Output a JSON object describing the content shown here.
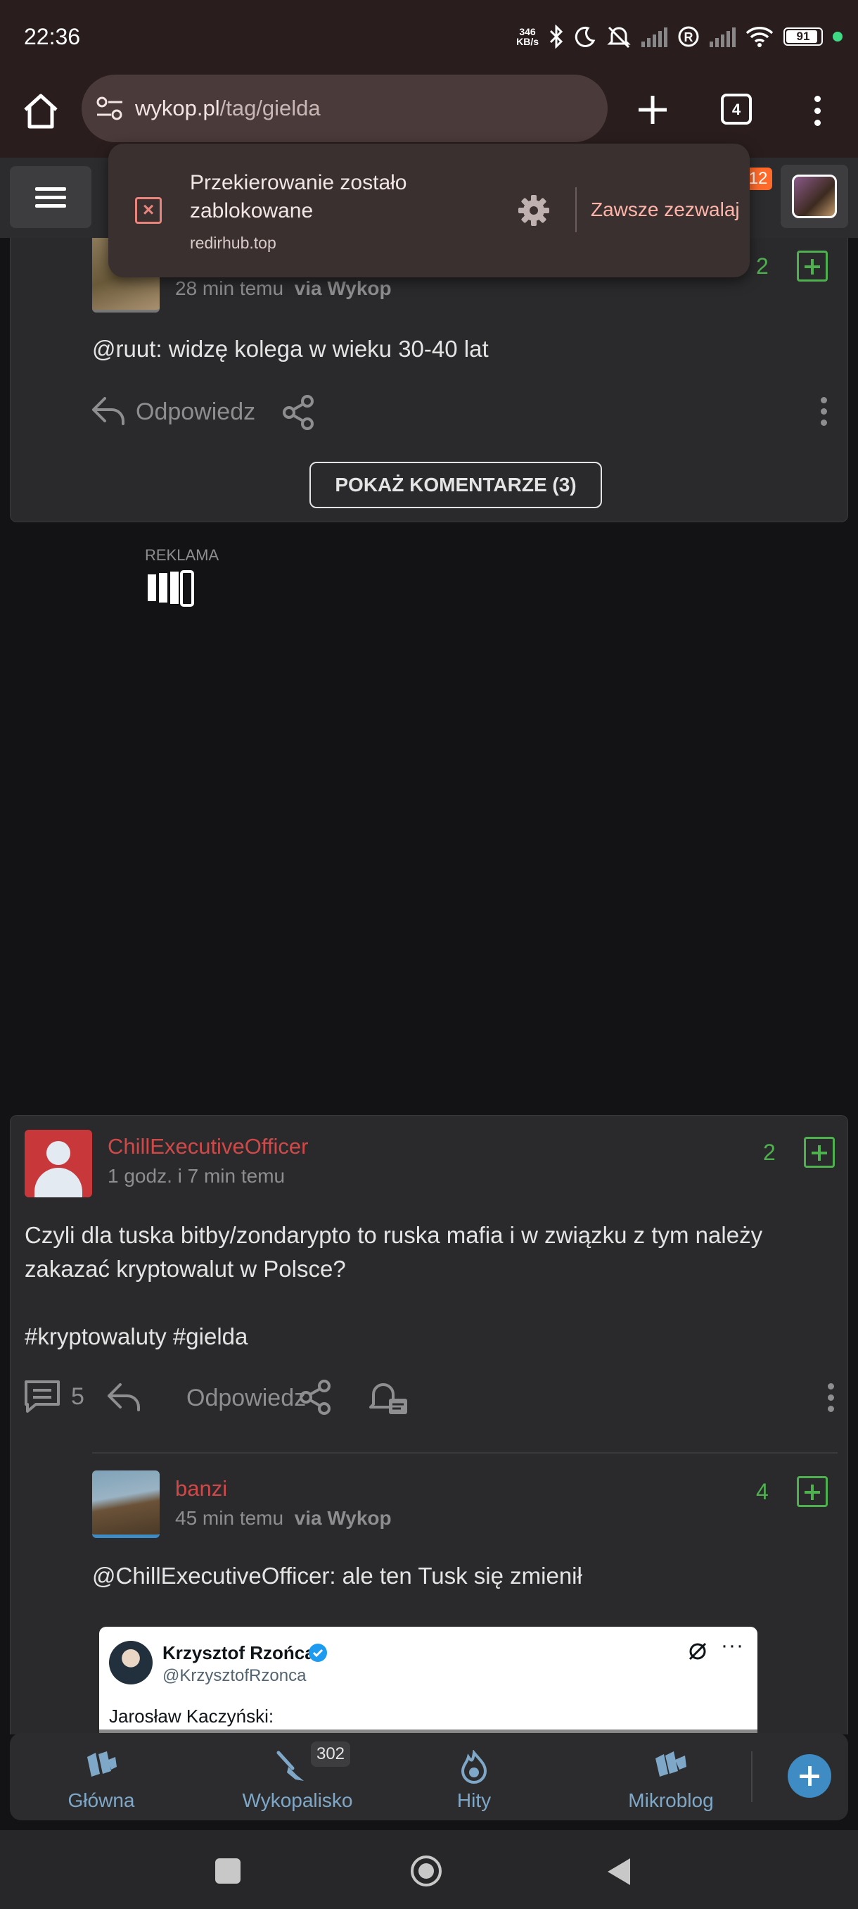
{
  "status_bar": {
    "time": "22:36",
    "net_speed_value": "346",
    "net_speed_unit": "KB/s",
    "battery": "91"
  },
  "browser": {
    "url_host": "wykop.pl",
    "url_path": "/tag/gielda",
    "tab_count": "4"
  },
  "site_header": {
    "notification_count": "12"
  },
  "popup": {
    "title": "Przekierowanie zostało zablokowane",
    "domain": "redirhub.top",
    "allow_label": "Zawsze zezwalaj"
  },
  "comment1": {
    "time": "28 min temu",
    "via": "via Wykop",
    "votes": "2",
    "mention": "@ruut",
    "text": ": widzę kolega w wieku 30-40 lat",
    "reply_label": "Odpowiedz",
    "show_comments_label": "POKAŻ KOMENTARZE (3)"
  },
  "ad": {
    "label": "REKLAMA"
  },
  "post": {
    "author": "ChillExecutiveOfficer",
    "time": "1 godz. i 7 min temu",
    "votes": "2",
    "text": "Czyli dla tuska bitby/zondarypto to ruska mafia i w związku z tym należy zakazać kryptowalut w Polsce?",
    "tags": "#kryptowaluty #gielda",
    "comment_count": "5",
    "reply_label": "Odpowiedz"
  },
  "comment2": {
    "author": "banzi",
    "time": "45 min temu",
    "via": "via Wykop",
    "votes": "4",
    "mention": "@ChillExecutiveOfficer",
    "text": ": ale ten Tusk się zmienił",
    "embed": {
      "name": "Krzysztof Rzońca",
      "handle": "@KrzysztofRzonca",
      "text": "Jarosław Kaczyński:"
    }
  },
  "bottom_nav": {
    "items": [
      {
        "label": "Główna"
      },
      {
        "label": "Wykopalisko"
      },
      {
        "label": "Hity"
      },
      {
        "label": "Mikroblog"
      }
    ],
    "wykopalisko_badge": "302"
  },
  "colors": {
    "accent_red": "#d04848",
    "vote_green": "#4fb04f",
    "nav_blue": "#7fa8c8",
    "fab_blue": "#3f8bc4",
    "badge_orange": "#ff6a2a"
  }
}
